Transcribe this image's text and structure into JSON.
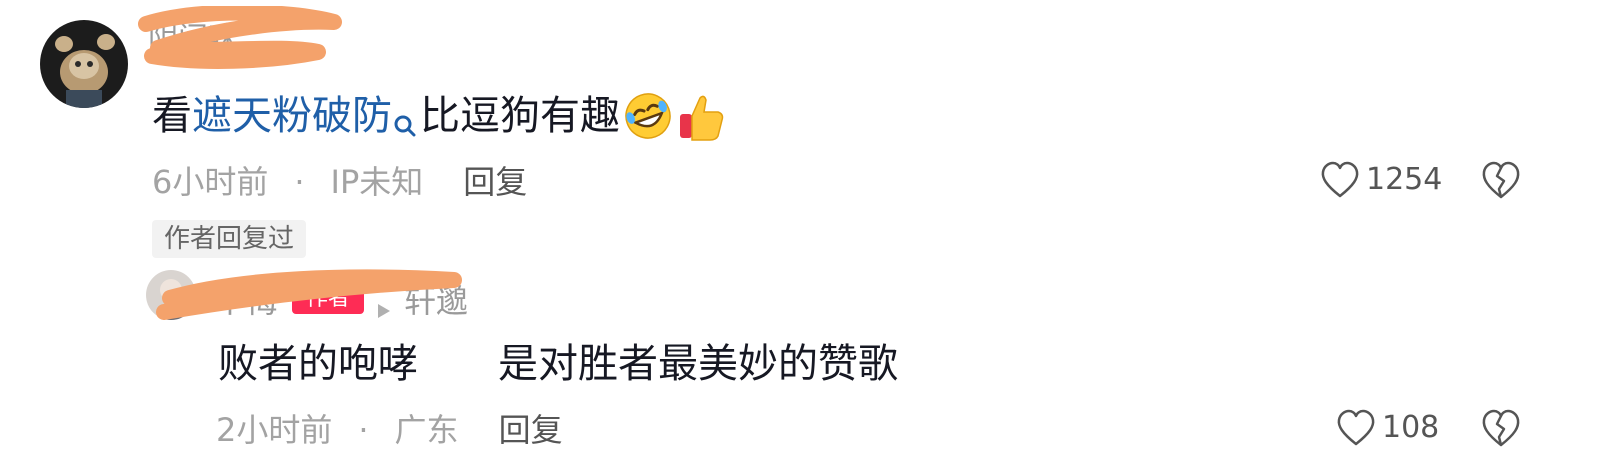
{
  "comment": {
    "username": "阴间味",
    "text_prefix": "看",
    "link_text": "遮天粉破防",
    "text_suffix": "比逗狗有趣",
    "time": "6小时前",
    "separator": "·",
    "location": "IP未知",
    "reply_label": "回复",
    "likes": "1254",
    "author_replied_tag": "作者回复过",
    "emojis": [
      "rofl-emoji",
      "thumbs-up-emoji"
    ]
  },
  "reply": {
    "username": "不悔",
    "author_badge": "作者",
    "reply_to": "轩邈",
    "text": "败者的咆哮　　是对胜者最美妙的赞歌",
    "time": "2小时前",
    "separator": "·",
    "location": "广东",
    "reply_label": "回复",
    "likes": "108"
  },
  "colors": {
    "link": "#1f5fa8",
    "author_badge": "#fe2c55",
    "scribble": "#f4a26b",
    "meta": "#a3a3a3"
  }
}
